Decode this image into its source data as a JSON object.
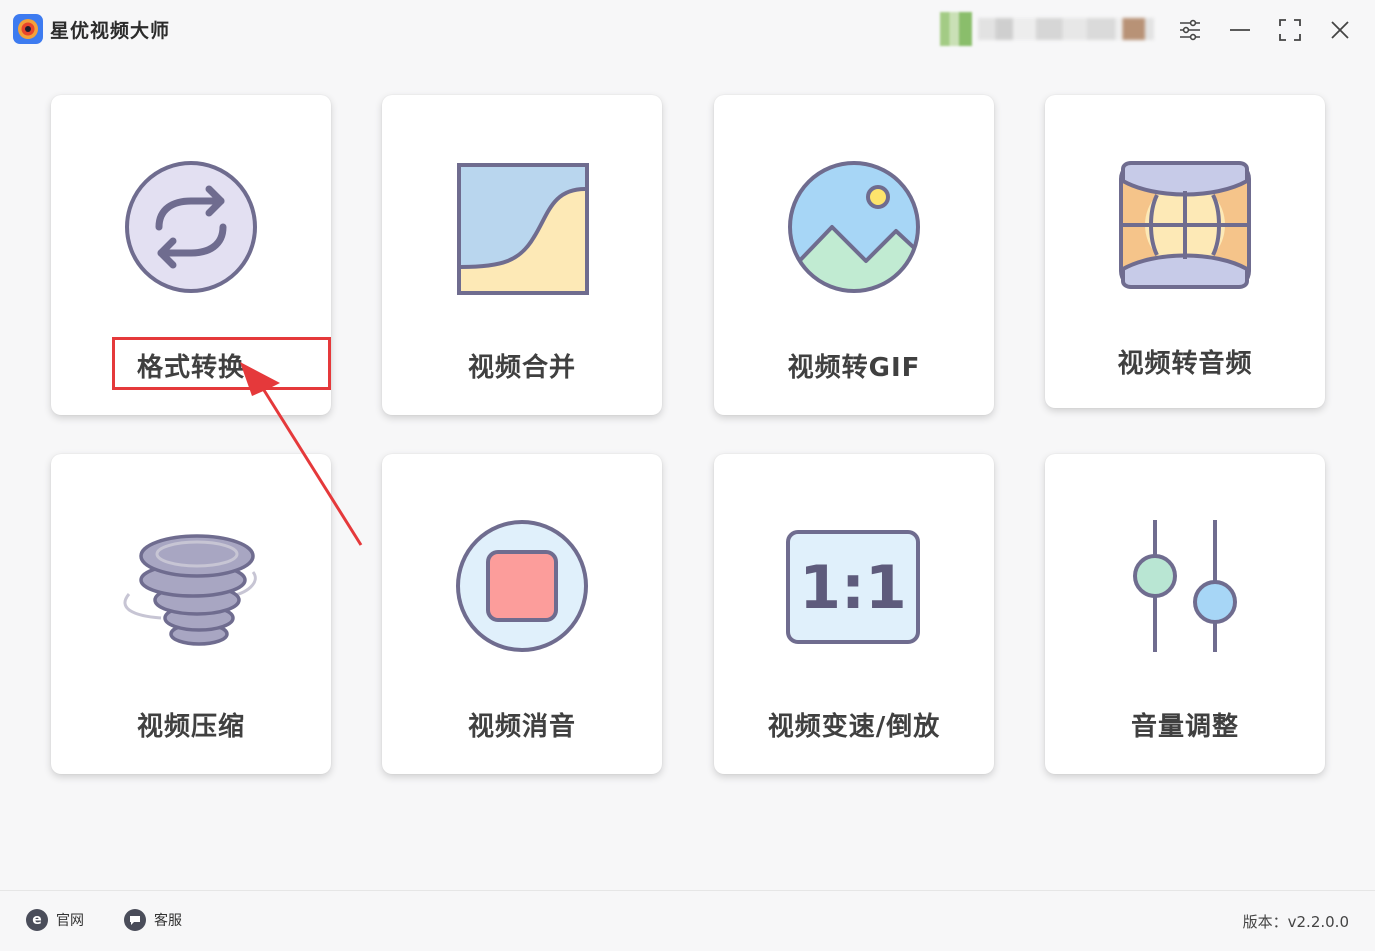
{
  "app": {
    "title": "星优视频大师"
  },
  "user": {
    "name": ""
  },
  "window_controls": [
    "settings-icon",
    "minimize-icon",
    "maximize-icon",
    "close-icon"
  ],
  "tools": [
    {
      "id": "format",
      "label": "格式转换",
      "icon": "convert-icon",
      "highlighted": true
    },
    {
      "id": "merge",
      "label": "视频合并",
      "icon": "merge-icon"
    },
    {
      "id": "gif",
      "label": "视频转GIF",
      "icon": "image-icon"
    },
    {
      "id": "audio",
      "label": "视频转音频",
      "icon": "audio-extract-icon"
    },
    {
      "id": "compress",
      "label": "视频压缩",
      "icon": "tornado-icon"
    },
    {
      "id": "mute",
      "label": "视频消音",
      "icon": "stop-icon"
    },
    {
      "id": "speed",
      "label": "视频变速/倒放",
      "icon": "ratio-icon",
      "icon_text": "1:1"
    },
    {
      "id": "volume",
      "label": "音量调整",
      "icon": "slider-icon"
    }
  ],
  "footer": {
    "website": {
      "label": "官网",
      "icon_text": "e"
    },
    "support": {
      "label": "客服"
    },
    "version": "版本：v2.2.0.0"
  },
  "colors": {
    "highlight": "#e5393b",
    "icon_stroke": "#6f6c8f",
    "background": "#f7f7f8"
  }
}
